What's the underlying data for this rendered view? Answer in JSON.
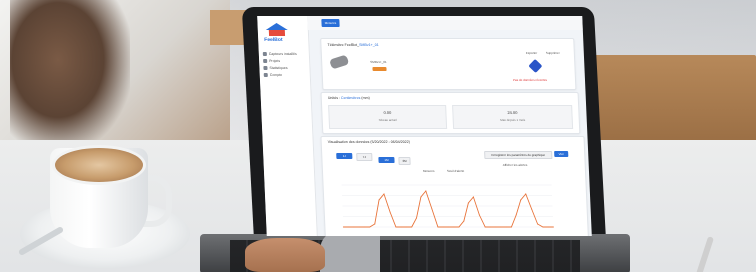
{
  "app": {
    "logo_text": "FeelBot",
    "top_button": "Mesures"
  },
  "sidebar": {
    "items": [
      {
        "label": "Capteurs installés",
        "icon": "sensor-icon"
      },
      {
        "label": "Projets",
        "icon": "project-icon"
      },
      {
        "label": "Statistiques",
        "icon": "stats-icon"
      },
      {
        "label": "Compte",
        "icon": "user-icon"
      }
    ]
  },
  "device_panel": {
    "title_prefix": "Télémètre FeelBot_",
    "title_link": "SMBv1+_01",
    "device_name": "SMBv1+_01",
    "status_badge": "",
    "actions": [
      "Exporter",
      "Supprimer"
    ],
    "alert_text": "Pas de données récentes"
  },
  "stats_panel": {
    "label_prefix": "Unités :",
    "label_link": "Centimètres",
    "label_suffix": "(mm)",
    "stat1": {
      "value": "0.00",
      "label": "Niveau actuel"
    },
    "stat2": {
      "value": "24.00",
      "label": "Max depuis 1 mois"
    }
  },
  "chart_panel": {
    "title": "Visualisation des données (5/20/2022 - 06/04/2022)",
    "range_buttons": [
      "1J",
      "7J",
      "1M",
      "3M"
    ],
    "save_button": "Enregistrer les paramètres du graphique",
    "export_button": "Vue",
    "toggle_label": "Afficher les alertes",
    "legend": [
      "Mesures",
      "Seuil d'alerte"
    ]
  },
  "colors": {
    "accent": "#2a6fd8",
    "series": "#e8743b",
    "badge": "#e88a2e",
    "alert": "#d33333"
  },
  "chart_data": {
    "type": "line",
    "x": [
      0,
      1,
      2,
      3,
      4,
      5,
      6,
      7,
      8,
      9,
      10,
      11,
      12,
      13,
      14,
      15,
      16,
      17,
      18,
      19,
      20,
      21,
      22,
      23,
      24,
      25,
      26,
      27,
      28,
      29,
      30,
      31,
      32,
      33,
      34,
      35,
      36,
      37,
      38,
      39,
      40
    ],
    "series": [
      {
        "values": [
          0,
          0,
          0,
          0,
          0,
          0,
          2,
          18,
          22,
          10,
          0,
          0,
          0,
          0,
          6,
          20,
          24,
          12,
          0,
          0,
          0,
          0,
          0,
          4,
          16,
          20,
          8,
          0,
          0,
          0,
          0,
          0,
          0,
          8,
          18,
          22,
          12,
          2,
          0,
          0,
          0
        ]
      }
    ],
    "ylim": [
      0,
      28
    ]
  }
}
